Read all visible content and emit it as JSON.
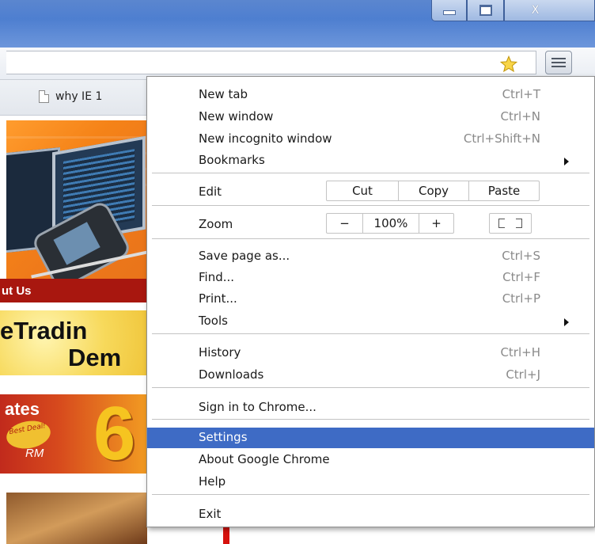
{
  "bookmarks_bar": {
    "page_tab_label": "why IE 1"
  },
  "page": {
    "nav_strip_label": "ut Us",
    "promo_line1": "eTradin",
    "promo_line2": "Dem",
    "rates_title": "ates",
    "best_deal_text": "Best Deal!",
    "rm_label": "RM",
    "big_number": "6"
  },
  "menu": {
    "new_tab": {
      "label": "New tab",
      "shortcut": "Ctrl+T"
    },
    "new_window": {
      "label": "New window",
      "shortcut": "Ctrl+N"
    },
    "new_incognito": {
      "label": "New incognito window",
      "shortcut": "Ctrl+Shift+N"
    },
    "bookmarks": {
      "label": "Bookmarks"
    },
    "edit": {
      "label": "Edit",
      "cut": "Cut",
      "copy": "Copy",
      "paste": "Paste"
    },
    "zoom": {
      "label": "Zoom",
      "minus": "−",
      "level": "100%",
      "plus": "+"
    },
    "save_page_as": {
      "label": "Save page as...",
      "shortcut": "Ctrl+S"
    },
    "find": {
      "label": "Find...",
      "shortcut": "Ctrl+F"
    },
    "print": {
      "label": "Print...",
      "shortcut": "Ctrl+P"
    },
    "tools": {
      "label": "Tools"
    },
    "history": {
      "label": "History",
      "shortcut": "Ctrl+H"
    },
    "downloads": {
      "label": "Downloads",
      "shortcut": "Ctrl+J"
    },
    "sign_in": {
      "label": "Sign in to Chrome..."
    },
    "settings": {
      "label": "Settings"
    },
    "about": {
      "label": "About Google Chrome"
    },
    "help": {
      "label": "Help"
    },
    "exit": {
      "label": "Exit"
    },
    "highlight_color": "#3e6bc5"
  },
  "window_buttons": {
    "close_glyph": "X"
  },
  "icons": [
    "minimize-icon",
    "maximize-icon",
    "close-icon",
    "star-icon",
    "hamburger-menu-icon",
    "page-icon",
    "submenu-arrow-icon",
    "fullscreen-icon"
  ]
}
